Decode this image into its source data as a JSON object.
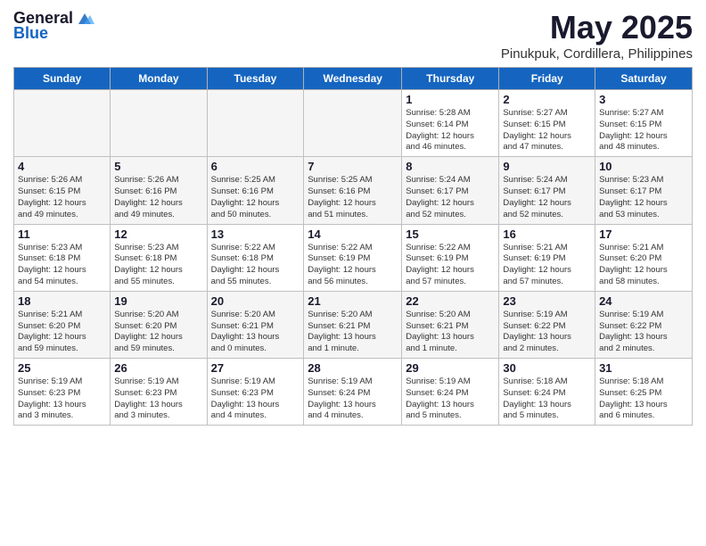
{
  "logo": {
    "general": "General",
    "blue": "Blue"
  },
  "title": "May 2025",
  "subtitle": "Pinukpuk, Cordillera, Philippines",
  "weekdays": [
    "Sunday",
    "Monday",
    "Tuesday",
    "Wednesday",
    "Thursday",
    "Friday",
    "Saturday"
  ],
  "weeks": [
    [
      {
        "day": "",
        "info": ""
      },
      {
        "day": "",
        "info": ""
      },
      {
        "day": "",
        "info": ""
      },
      {
        "day": "",
        "info": ""
      },
      {
        "day": "1",
        "info": "Sunrise: 5:28 AM\nSunset: 6:14 PM\nDaylight: 12 hours\nand 46 minutes."
      },
      {
        "day": "2",
        "info": "Sunrise: 5:27 AM\nSunset: 6:15 PM\nDaylight: 12 hours\nand 47 minutes."
      },
      {
        "day": "3",
        "info": "Sunrise: 5:27 AM\nSunset: 6:15 PM\nDaylight: 12 hours\nand 48 minutes."
      }
    ],
    [
      {
        "day": "4",
        "info": "Sunrise: 5:26 AM\nSunset: 6:15 PM\nDaylight: 12 hours\nand 49 minutes."
      },
      {
        "day": "5",
        "info": "Sunrise: 5:26 AM\nSunset: 6:16 PM\nDaylight: 12 hours\nand 49 minutes."
      },
      {
        "day": "6",
        "info": "Sunrise: 5:25 AM\nSunset: 6:16 PM\nDaylight: 12 hours\nand 50 minutes."
      },
      {
        "day": "7",
        "info": "Sunrise: 5:25 AM\nSunset: 6:16 PM\nDaylight: 12 hours\nand 51 minutes."
      },
      {
        "day": "8",
        "info": "Sunrise: 5:24 AM\nSunset: 6:17 PM\nDaylight: 12 hours\nand 52 minutes."
      },
      {
        "day": "9",
        "info": "Sunrise: 5:24 AM\nSunset: 6:17 PM\nDaylight: 12 hours\nand 52 minutes."
      },
      {
        "day": "10",
        "info": "Sunrise: 5:23 AM\nSunset: 6:17 PM\nDaylight: 12 hours\nand 53 minutes."
      }
    ],
    [
      {
        "day": "11",
        "info": "Sunrise: 5:23 AM\nSunset: 6:18 PM\nDaylight: 12 hours\nand 54 minutes."
      },
      {
        "day": "12",
        "info": "Sunrise: 5:23 AM\nSunset: 6:18 PM\nDaylight: 12 hours\nand 55 minutes."
      },
      {
        "day": "13",
        "info": "Sunrise: 5:22 AM\nSunset: 6:18 PM\nDaylight: 12 hours\nand 55 minutes."
      },
      {
        "day": "14",
        "info": "Sunrise: 5:22 AM\nSunset: 6:19 PM\nDaylight: 12 hours\nand 56 minutes."
      },
      {
        "day": "15",
        "info": "Sunrise: 5:22 AM\nSunset: 6:19 PM\nDaylight: 12 hours\nand 57 minutes."
      },
      {
        "day": "16",
        "info": "Sunrise: 5:21 AM\nSunset: 6:19 PM\nDaylight: 12 hours\nand 57 minutes."
      },
      {
        "day": "17",
        "info": "Sunrise: 5:21 AM\nSunset: 6:20 PM\nDaylight: 12 hours\nand 58 minutes."
      }
    ],
    [
      {
        "day": "18",
        "info": "Sunrise: 5:21 AM\nSunset: 6:20 PM\nDaylight: 12 hours\nand 59 minutes."
      },
      {
        "day": "19",
        "info": "Sunrise: 5:20 AM\nSunset: 6:20 PM\nDaylight: 12 hours\nand 59 minutes."
      },
      {
        "day": "20",
        "info": "Sunrise: 5:20 AM\nSunset: 6:21 PM\nDaylight: 13 hours\nand 0 minutes."
      },
      {
        "day": "21",
        "info": "Sunrise: 5:20 AM\nSunset: 6:21 PM\nDaylight: 13 hours\nand 1 minute."
      },
      {
        "day": "22",
        "info": "Sunrise: 5:20 AM\nSunset: 6:21 PM\nDaylight: 13 hours\nand 1 minute."
      },
      {
        "day": "23",
        "info": "Sunrise: 5:19 AM\nSunset: 6:22 PM\nDaylight: 13 hours\nand 2 minutes."
      },
      {
        "day": "24",
        "info": "Sunrise: 5:19 AM\nSunset: 6:22 PM\nDaylight: 13 hours\nand 2 minutes."
      }
    ],
    [
      {
        "day": "25",
        "info": "Sunrise: 5:19 AM\nSunset: 6:23 PM\nDaylight: 13 hours\nand 3 minutes."
      },
      {
        "day": "26",
        "info": "Sunrise: 5:19 AM\nSunset: 6:23 PM\nDaylight: 13 hours\nand 3 minutes."
      },
      {
        "day": "27",
        "info": "Sunrise: 5:19 AM\nSunset: 6:23 PM\nDaylight: 13 hours\nand 4 minutes."
      },
      {
        "day": "28",
        "info": "Sunrise: 5:19 AM\nSunset: 6:24 PM\nDaylight: 13 hours\nand 4 minutes."
      },
      {
        "day": "29",
        "info": "Sunrise: 5:19 AM\nSunset: 6:24 PM\nDaylight: 13 hours\nand 5 minutes."
      },
      {
        "day": "30",
        "info": "Sunrise: 5:18 AM\nSunset: 6:24 PM\nDaylight: 13 hours\nand 5 minutes."
      },
      {
        "day": "31",
        "info": "Sunrise: 5:18 AM\nSunset: 6:25 PM\nDaylight: 13 hours\nand 6 minutes."
      }
    ]
  ]
}
